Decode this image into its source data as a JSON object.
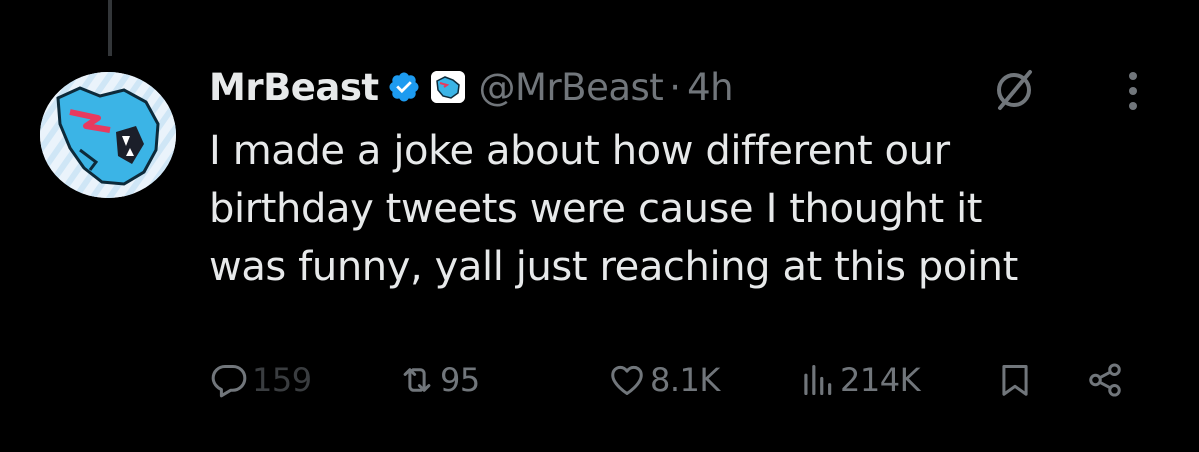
{
  "tweet": {
    "author_name": "MrBeast",
    "handle": "@MrBeast",
    "separator": "·",
    "time": "4h",
    "lines": [
      "I made a joke about how different our",
      "birthday tweets were cause I thought it",
      "was funny, yall just reaching at this point"
    ]
  },
  "actions": {
    "replies": "159",
    "reposts": "95",
    "likes": "8.1K",
    "views": "214K"
  },
  "icons": {
    "verified": "verified-badge-icon",
    "affiliate": "affiliate-badge-icon",
    "grok": "grok-icon",
    "more": "more-icon",
    "reply": "reply-icon",
    "repost": "repost-icon",
    "like": "heart-icon",
    "views": "views-icon",
    "bookmark": "bookmark-icon",
    "share": "share-icon"
  },
  "colors": {
    "background": "#000000",
    "text": "#e7e9ea",
    "muted": "#71767b",
    "verified": "#1d9bf0"
  }
}
